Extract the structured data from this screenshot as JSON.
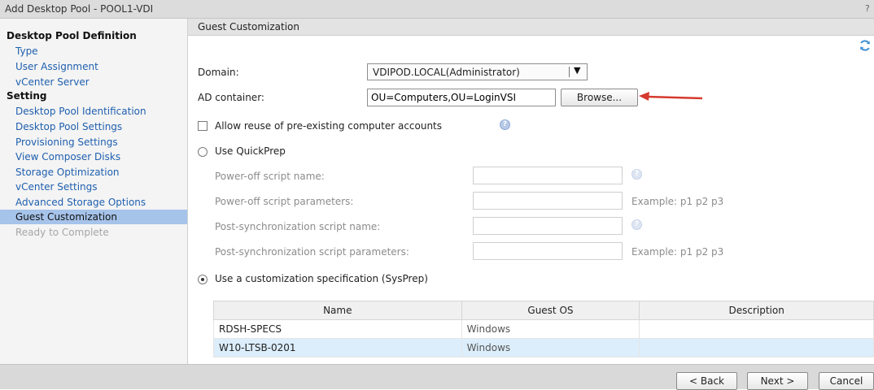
{
  "window": {
    "title": "Add Desktop Pool - POOL1-VDI",
    "help_glyph": "?"
  },
  "sidebar": {
    "items": [
      {
        "label": "Desktop Pool Definition",
        "kind": "header"
      },
      {
        "label": "Type",
        "kind": "link"
      },
      {
        "label": "User Assignment",
        "kind": "link"
      },
      {
        "label": "vCenter Server",
        "kind": "link"
      },
      {
        "label": "Setting",
        "kind": "header"
      },
      {
        "label": "Desktop Pool Identification",
        "kind": "link"
      },
      {
        "label": "Desktop Pool Settings",
        "kind": "link"
      },
      {
        "label": "Provisioning Settings",
        "kind": "link"
      },
      {
        "label": "View Composer Disks",
        "kind": "link"
      },
      {
        "label": "Storage Optimization",
        "kind": "link"
      },
      {
        "label": "vCenter Settings",
        "kind": "link"
      },
      {
        "label": "Advanced Storage Options",
        "kind": "link"
      },
      {
        "label": "Guest Customization",
        "kind": "selected"
      },
      {
        "label": "Ready to Complete",
        "kind": "disabled"
      }
    ]
  },
  "main": {
    "section_title": "Guest Customization",
    "refresh_icon": "refresh-icon",
    "domain": {
      "label": "Domain:",
      "value": "VDIPOD.LOCAL(Administrator)",
      "arrow": "▼"
    },
    "ad_container": {
      "label": "AD container:",
      "value": "OU=Computers,OU=LoginVSI",
      "browse_label": "Browse..."
    },
    "allow_reuse": {
      "label": "Allow reuse of pre-existing computer accounts",
      "checked": false
    },
    "quickprep": {
      "label": "Use QuickPrep",
      "selected": false,
      "fields": {
        "poweroff_name": {
          "label": "Power-off script name:",
          "value": ""
        },
        "poweroff_params": {
          "label": "Power-off script parameters:",
          "value": "",
          "hint": "Example: p1 p2 p3"
        },
        "postsync_name": {
          "label": "Post-synchronization script name:",
          "value": ""
        },
        "postsync_params": {
          "label": "Post-synchronization script parameters:",
          "value": "",
          "hint": "Example: p1 p2 p3"
        }
      }
    },
    "sysprep": {
      "label": "Use a customization specification (SysPrep)",
      "selected": true,
      "columns": [
        "Name",
        "Guest OS",
        "Description"
      ],
      "rows": [
        {
          "name": "RDSH-SPECS",
          "os": "Windows",
          "description": "",
          "selected": false
        },
        {
          "name": "W10-LTSB-0201",
          "os": "Windows",
          "description": "",
          "selected": true
        }
      ]
    }
  },
  "footer": {
    "back_label": "< Back",
    "next_label": "Next >",
    "cancel_label": "Cancel"
  },
  "colors": {
    "selected_nav": "#a6c3ea",
    "link": "#1f5fae",
    "annotation_arrow": "#d63a2e"
  }
}
